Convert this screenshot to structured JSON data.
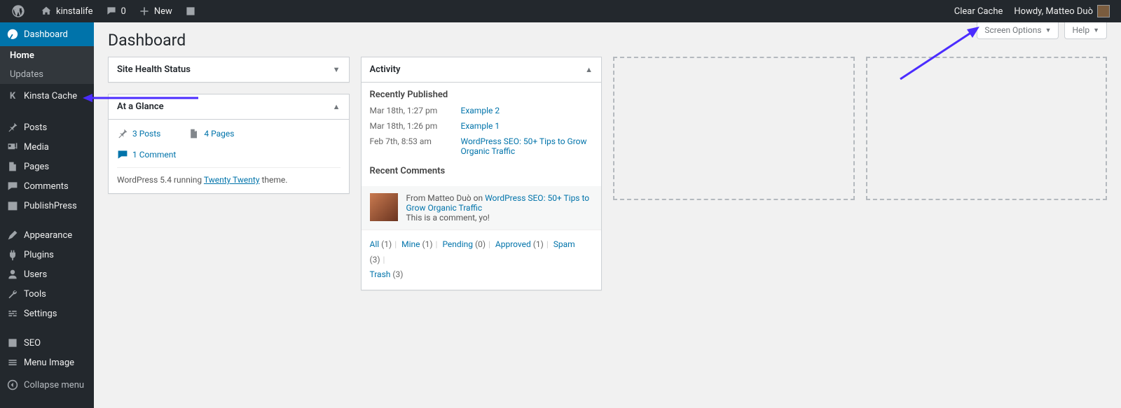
{
  "adminbar": {
    "site_name": "kinstalife",
    "comments_count": "0",
    "new_label": "New",
    "clear_cache": "Clear Cache",
    "howdy": "Howdy, Matteo Duò"
  },
  "screen_meta": {
    "screen_options": "Screen Options",
    "help": "Help"
  },
  "sidebar": {
    "dashboard": "Dashboard",
    "submenu": {
      "home": "Home",
      "updates": "Updates"
    },
    "kinsta_cache": "Kinsta Cache",
    "posts": "Posts",
    "media": "Media",
    "pages": "Pages",
    "comments": "Comments",
    "publishpress": "PublishPress",
    "appearance": "Appearance",
    "plugins": "Plugins",
    "users": "Users",
    "tools": "Tools",
    "settings": "Settings",
    "seo": "SEO",
    "menu_image": "Menu Image",
    "collapse": "Collapse menu"
  },
  "page_title": "Dashboard",
  "widgets": {
    "site_health": {
      "title": "Site Health Status"
    },
    "at_a_glance": {
      "title": "At a Glance",
      "posts": "3 Posts",
      "pages": "4 Pages",
      "comment": "1 Comment",
      "version_pre": "WordPress 5.4 running ",
      "theme": "Twenty Twenty",
      "version_post": " theme."
    },
    "activity": {
      "title": "Activity",
      "recently_published": "Recently Published",
      "pubs": [
        {
          "date": "Mar 18th, 1:27 pm",
          "title": "Example 2"
        },
        {
          "date": "Mar 18th, 1:26 pm",
          "title": "Example 1"
        },
        {
          "date": "Feb 7th, 8:53 am",
          "title": "WordPress SEO: 50+ Tips to Grow Organic Traffic"
        }
      ],
      "recent_comments": "Recent Comments",
      "comment_from_pre": "From Matteo Duò on ",
      "comment_on_post": "WordPress SEO: 50+ Tips to Grow Organic Traffic",
      "comment_text": "This is a comment, yo!",
      "filters": {
        "all": "All",
        "all_count": "(1)",
        "mine": "Mine",
        "mine_count": "(1)",
        "pending": "Pending",
        "pending_count": "(0)",
        "approved": "Approved",
        "approved_count": "(1)",
        "spam": "Spam",
        "spam_count": "(3)",
        "trash": "Trash",
        "trash_count": "(3)"
      }
    }
  }
}
